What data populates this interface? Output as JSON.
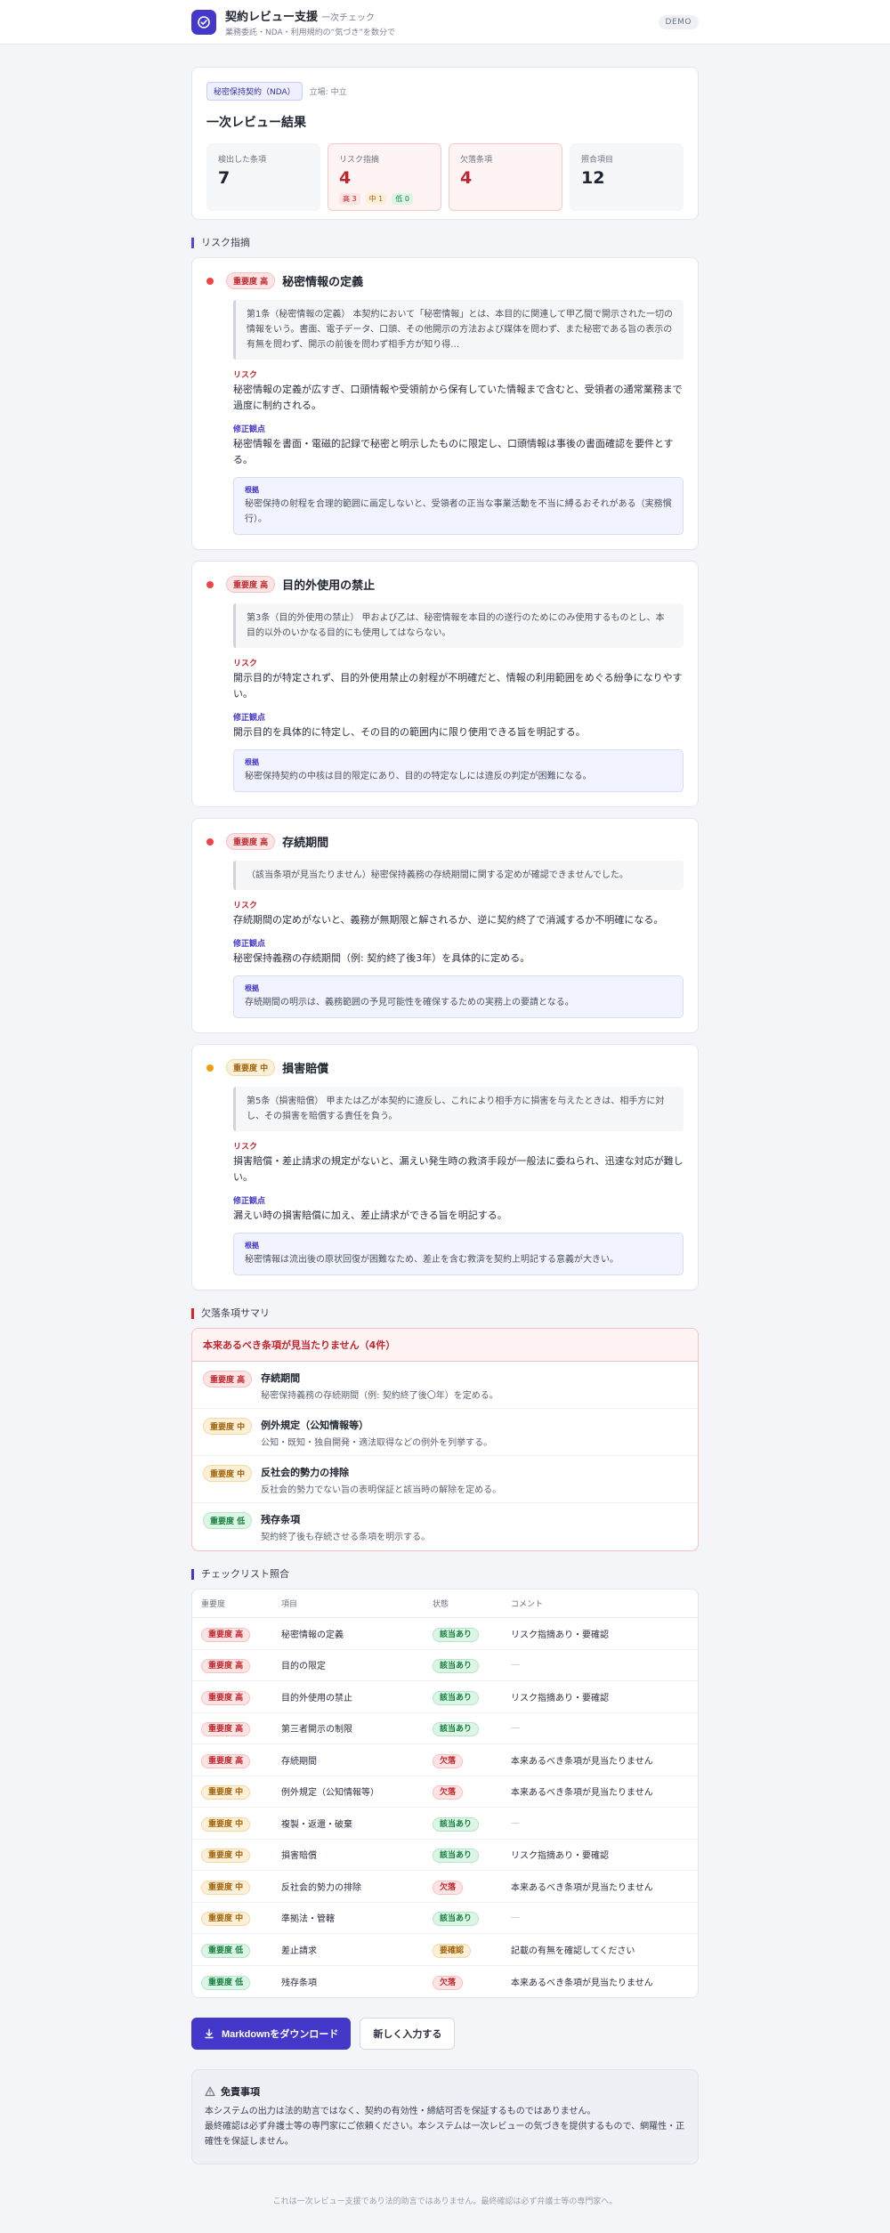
{
  "header": {
    "title": "契約レビュー支援",
    "subtitle": "一次チェック",
    "description": "業務委託・NDA・利用規約の“気づき”を数分で",
    "badge": "DEMO"
  },
  "summary": {
    "contract_type": "秘密保持契約（NDA）",
    "stance": "立場: 中立",
    "title": "一次レビュー結果",
    "stats": [
      {
        "label": "検出した条項",
        "value": "7"
      },
      {
        "label": "リスク指摘",
        "value": "4",
        "breakdown": {
          "high": "高 3",
          "mid": "中 1",
          "low": "低 0"
        }
      },
      {
        "label": "欠落条項",
        "value": "4"
      },
      {
        "label": "照合項目",
        "value": "12"
      }
    ]
  },
  "risk_section_title": "リスク指摘",
  "labels": {
    "risk": "リスク",
    "fix": "修正観点",
    "basis": "根拠"
  },
  "risks": [
    {
      "severity": "重要度 高",
      "title": "秘密情報の定義",
      "quote": "第1条（秘密情報の定義） 本契約において「秘密情報」とは、本目的に関連して甲乙間で開示された一切の情報をいう。書面、電子データ、口頭、その他開示の方法および媒体を問わず、また秘密である旨の表示の有無を問わず、開示の前後を問わず相手方が知り得…",
      "risk": "秘密情報の定義が広すぎ、口頭情報や受領前から保有していた情報まで含むと、受領者の通常業務まで過度に制約される。",
      "fix": "秘密情報を書面・電磁的記録で秘密と明示したものに限定し、口頭情報は事後の書面確認を要件とする。",
      "basis": "秘密保持の射程を合理的範囲に画定しないと、受領者の正当な事業活動を不当に縛るおそれがある（実務慣行）。"
    },
    {
      "severity": "重要度 高",
      "title": "目的外使用の禁止",
      "quote": "第3条（目的外使用の禁止） 甲および乙は、秘密情報を本目的の遂行のためにのみ使用するものとし、本目的以外のいかなる目的にも使用してはならない。",
      "risk": "開示目的が特定されず、目的外使用禁止の射程が不明確だと、情報の利用範囲をめぐる紛争になりやすい。",
      "fix": "開示目的を具体的に特定し、その目的の範囲内に限り使用できる旨を明記する。",
      "basis": "秘密保持契約の中核は目的限定にあり、目的の特定なしには違反の判定が困難になる。"
    },
    {
      "severity": "重要度 高",
      "title": "存続期間",
      "quote": "（該当条項が見当たりません）秘密保持義務の存続期間に関する定めが確認できませんでした。",
      "risk": "存続期間の定めがないと、義務が無期限と解されるか、逆に契約終了で消滅するか不明確になる。",
      "fix": "秘密保持義務の存続期間（例: 契約終了後3年）を具体的に定める。",
      "basis": "存続期間の明示は、義務範囲の予見可能性を確保するための実務上の要請となる。"
    },
    {
      "severity": "重要度 中",
      "title": "損害賠償",
      "quote": "第5条（損害賠償） 甲または乙が本契約に違反し、これにより相手方に損害を与えたときは、相手方に対し、その損害を賠償する責任を負う。",
      "risk": "損害賠償・差止請求の規定がないと、漏えい発生時の救済手段が一般法に委ねられ、迅速な対応が難しい。",
      "fix": "漏えい時の損害賠償に加え、差止請求ができる旨を明記する。",
      "basis": "秘密情報は流出後の原状回復が困難なため、差止を含む救済を契約上明記する意義が大きい。"
    }
  ],
  "missing_section_title": "欠落条項サマリ",
  "missing": {
    "header": "本来あるべき条項が見当たりません（4件）",
    "items": [
      {
        "severity": "重要度 高",
        "level": "high",
        "name": "存続期間",
        "desc": "秘密保持義務の存続期間（例: 契約終了後〇年）を定める。"
      },
      {
        "severity": "重要度 中",
        "level": "mid",
        "name": "例外規定（公知情報等）",
        "desc": "公知・既知・独自開発・適法取得などの例外を列挙する。"
      },
      {
        "severity": "重要度 中",
        "level": "mid",
        "name": "反社会的勢力の排除",
        "desc": "反社会的勢力でない旨の表明保証と該当時の解除を定める。"
      },
      {
        "severity": "重要度 低",
        "level": "low",
        "name": "残存条項",
        "desc": "契約終了後も存続させる条項を明示する。"
      }
    ]
  },
  "checklist_section_title": "チェックリスト照合",
  "checklist": {
    "columns": [
      "重要度",
      "項目",
      "状態",
      "コメント"
    ],
    "rows": [
      {
        "severity": "重要度 高",
        "level": "high",
        "item": "秘密情報の定義",
        "status": "該当あり",
        "st": "ok",
        "comment": "リスク指摘あり・要確認"
      },
      {
        "severity": "重要度 高",
        "level": "high",
        "item": "目的の限定",
        "status": "該当あり",
        "st": "ok",
        "comment": "—"
      },
      {
        "severity": "重要度 高",
        "level": "high",
        "item": "目的外使用の禁止",
        "status": "該当あり",
        "st": "ok",
        "comment": "リスク指摘あり・要確認"
      },
      {
        "severity": "重要度 高",
        "level": "high",
        "item": "第三者開示の制限",
        "status": "該当あり",
        "st": "ok",
        "comment": "—"
      },
      {
        "severity": "重要度 高",
        "level": "high",
        "item": "存続期間",
        "status": "欠落",
        "st": "ng",
        "comment": "本来あるべき条項が見当たりません"
      },
      {
        "severity": "重要度 中",
        "level": "mid",
        "item": "例外規定（公知情報等）",
        "status": "欠落",
        "st": "ng",
        "comment": "本来あるべき条項が見当たりません"
      },
      {
        "severity": "重要度 中",
        "level": "mid",
        "item": "複製・返還・破棄",
        "status": "該当あり",
        "st": "ok",
        "comment": "—"
      },
      {
        "severity": "重要度 中",
        "level": "mid",
        "item": "損害賠償",
        "status": "該当あり",
        "st": "ok",
        "comment": "リスク指摘あり・要確認"
      },
      {
        "severity": "重要度 中",
        "level": "mid",
        "item": "反社会的勢力の排除",
        "status": "欠落",
        "st": "ng",
        "comment": "本来あるべき条項が見当たりません"
      },
      {
        "severity": "重要度 中",
        "level": "mid",
        "item": "準拠法・管轄",
        "status": "該当あり",
        "st": "ok",
        "comment": "—"
      },
      {
        "severity": "重要度 低",
        "level": "low",
        "item": "差止請求",
        "status": "要確認",
        "st": "warn",
        "comment": "記載の有無を確認してください"
      },
      {
        "severity": "重要度 低",
        "level": "low",
        "item": "残存条項",
        "status": "欠落",
        "st": "ng",
        "comment": "本来あるべき条項が見当たりません"
      }
    ]
  },
  "actions": {
    "download": "Markdownをダウンロード",
    "new_input": "新しく入力する"
  },
  "disclaimer": {
    "title": "免責事項",
    "line1": "本システムの出力は法的助言ではなく、契約の有効性・締結可否を保証するものではありません。",
    "line2": "最終確認は必ず弁護士等の専門家にご依頼ください。本システムは一次レビューの気づきを提供するもので、網羅性・正確性を保証しません。"
  },
  "footer": "これは一次レビュー支援であり法的助言ではありません。最終確認は必ず弁護士等の専門家へ。"
}
